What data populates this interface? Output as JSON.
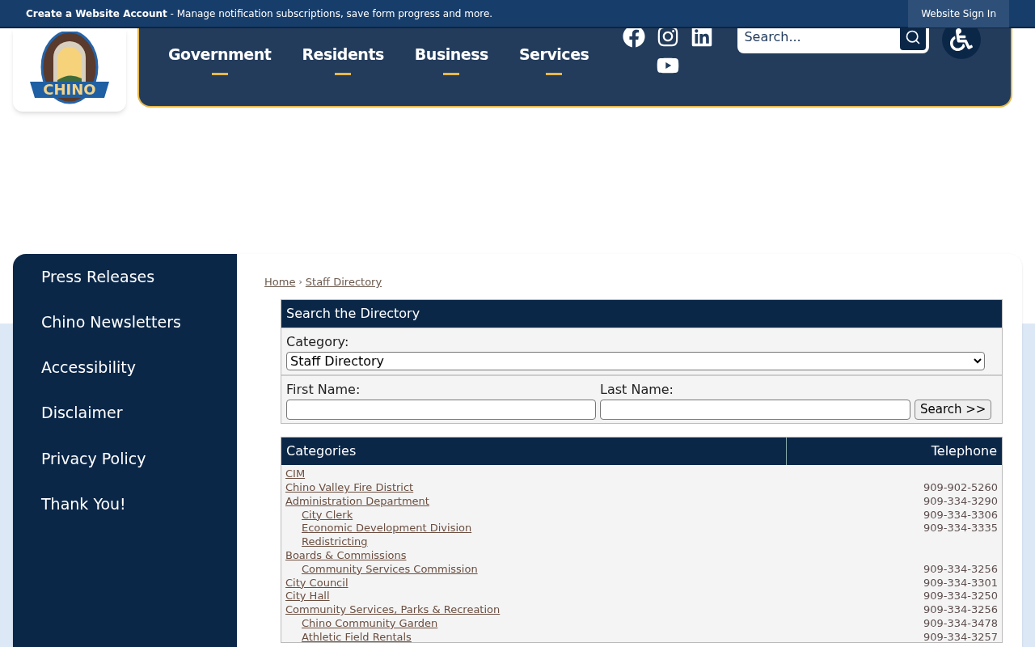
{
  "top_bar": {
    "title": "Create a Website Account",
    "message": " - Manage notification subscriptions, save form progress and more.",
    "sign_in": "Website Sign In"
  },
  "logo": {
    "text": "CHINO"
  },
  "nav": [
    {
      "label": "Government"
    },
    {
      "label": "Residents"
    },
    {
      "label": "Business"
    },
    {
      "label": "Services"
    }
  ],
  "search": {
    "placeholder": "Search..."
  },
  "sidebar": {
    "items": [
      {
        "label": "Press Releases"
      },
      {
        "label": "Chino Newsletters"
      },
      {
        "label": "Accessibility"
      },
      {
        "label": "Disclaimer"
      },
      {
        "label": "Privacy Policy"
      },
      {
        "label": "Thank You!"
      }
    ]
  },
  "breadcrumb": [
    "Home",
    "Staff Directory"
  ],
  "breadcrumb_separator": "›",
  "directory_search": {
    "title": "Search the Directory",
    "category_label": "Category:",
    "category_value": "Staff Directory",
    "first_name_label": "First Name:",
    "last_name_label": "Last Name:",
    "button": "Search >>"
  },
  "table": {
    "columns": [
      "Categories",
      "Telephone"
    ],
    "rows": [
      {
        "name": "CIM"
      },
      {
        "name": "Chino Valley Fire District",
        "phone": "909-902-5260"
      },
      {
        "name": "Administration Department",
        "phone": "909-334-3290",
        "children": [
          {
            "name": "City Clerk",
            "phone": "909-334-3306"
          },
          {
            "name": "Economic Development Division",
            "phone": "909-334-3335"
          },
          {
            "name": "Redistricting"
          }
        ]
      },
      {
        "name": "Boards & Commissions",
        "children": [
          {
            "name": "Community Services Commission",
            "phone": "909-334-3256"
          }
        ]
      },
      {
        "name": "City Council",
        "phone": "909-334-3301"
      },
      {
        "name": "City Hall",
        "phone": "909-334-3250"
      },
      {
        "name": "Community Services, Parks & Recreation",
        "phone": "909-334-3256",
        "children": [
          {
            "name": "Chino Community Garden",
            "phone": "909-334-3478"
          },
          {
            "name": "Athletic Field Rentals",
            "phone": "909-334-3257"
          }
        ]
      }
    ]
  }
}
